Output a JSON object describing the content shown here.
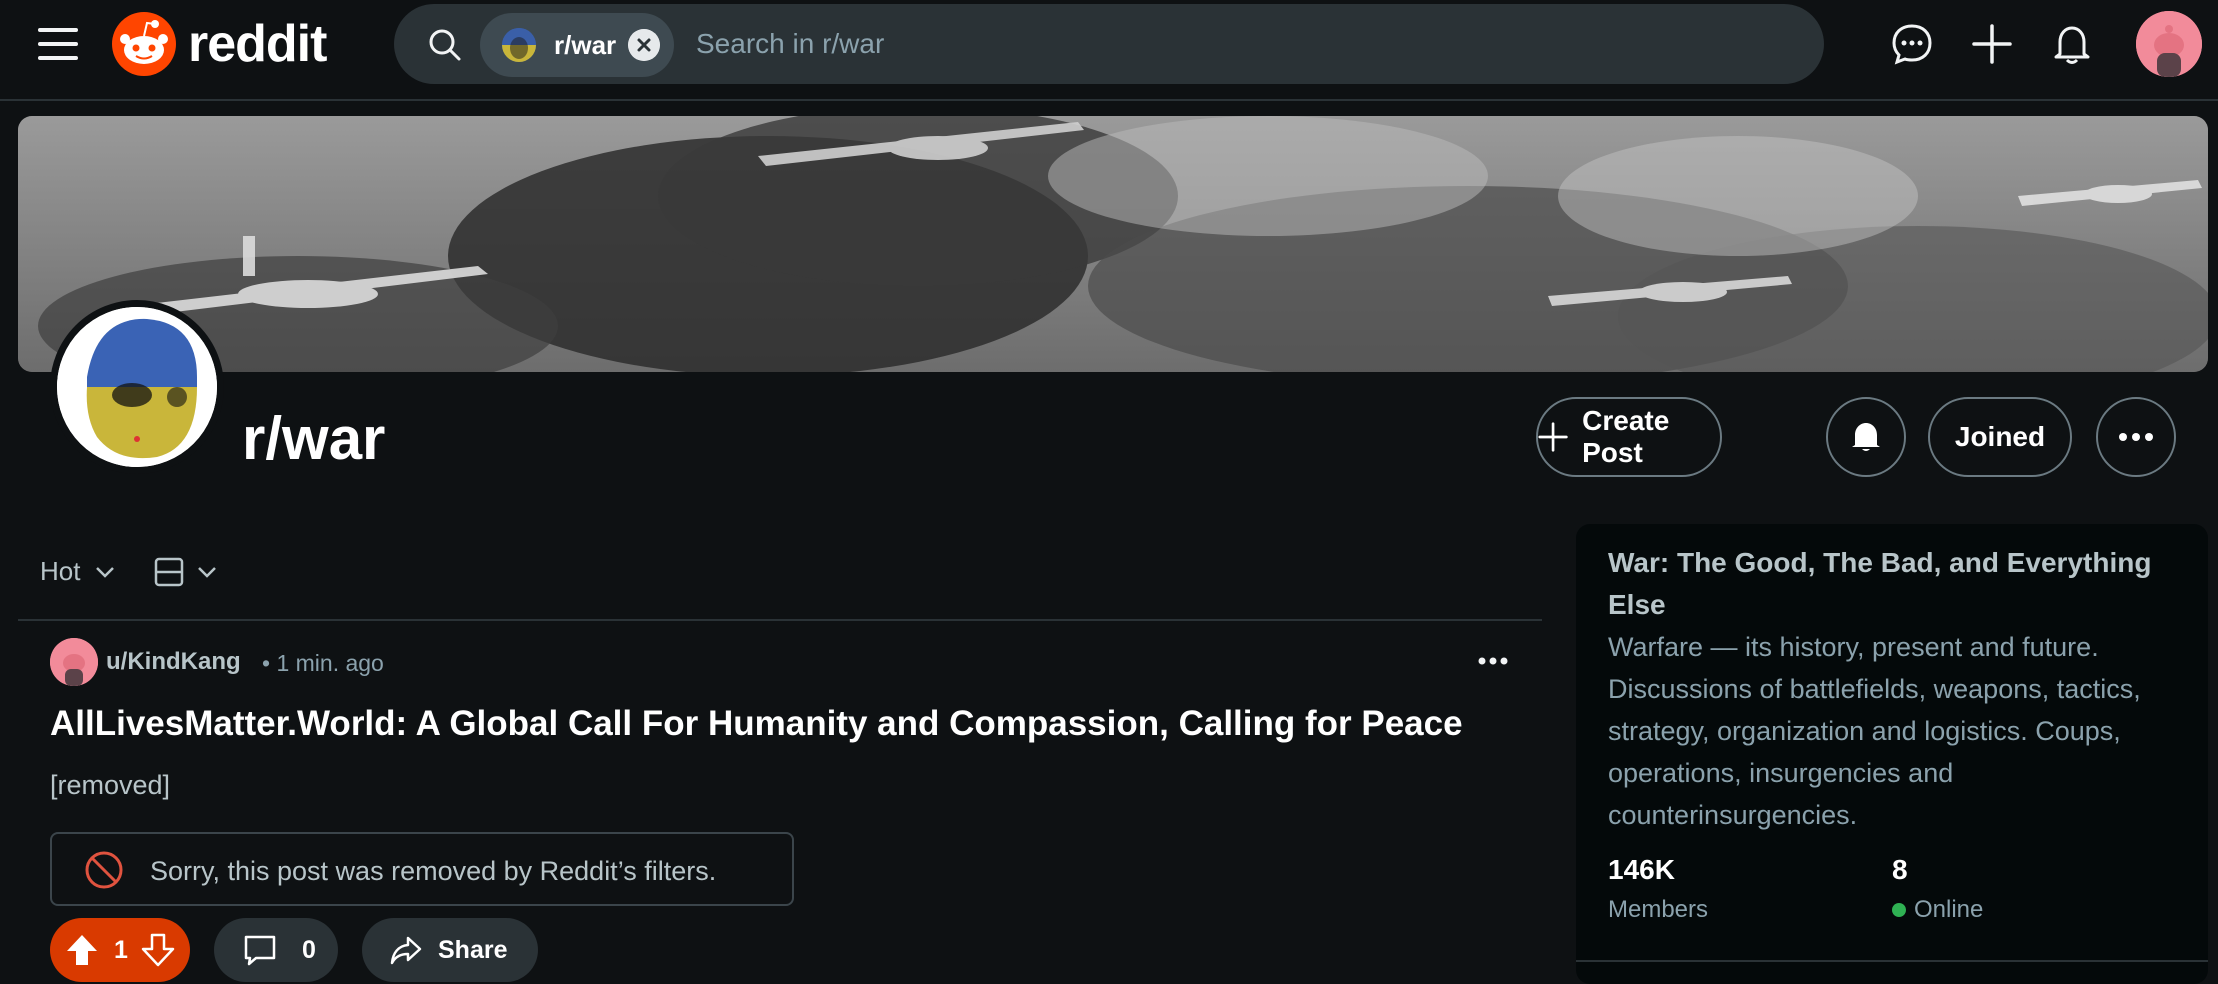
{
  "header": {
    "logo_text": "reddit",
    "search": {
      "community_chip": "r/war",
      "placeholder": "Search in r/war"
    },
    "icons": [
      "chat-icon",
      "plus-icon",
      "bell-icon"
    ]
  },
  "subreddit": {
    "name": "r/war",
    "actions": {
      "create_post": "Create Post",
      "joined": "Joined"
    }
  },
  "feed": {
    "sort_label": "Hot"
  },
  "post": {
    "author": "u/KindKang",
    "time": "1 min. ago",
    "title": "AllLivesMatter.World: A Global Call For Humanity and Compassion, Calling for Peace",
    "body": "[removed]",
    "removed_notice": "Sorry, this post was removed by Reddit’s filters.",
    "score": "1",
    "comment_count": "0",
    "share_label": "Share"
  },
  "sidebar": {
    "title": "War: The Good, The Bad, and Everything Else",
    "description": "Warfare — its history, present and future. Discussions of battlefields, weapons, tactics, strategy, organization and logistics. Coups, operations, insurgencies and counterinsurgencies.",
    "members_count": "146K",
    "members_label": "Members",
    "online_count": "8",
    "online_label": "Online"
  },
  "colors": {
    "background": "#0e1113",
    "upvote_active": "#d93a00",
    "brand_orange": "#ff4500",
    "online": "#2fb153"
  }
}
